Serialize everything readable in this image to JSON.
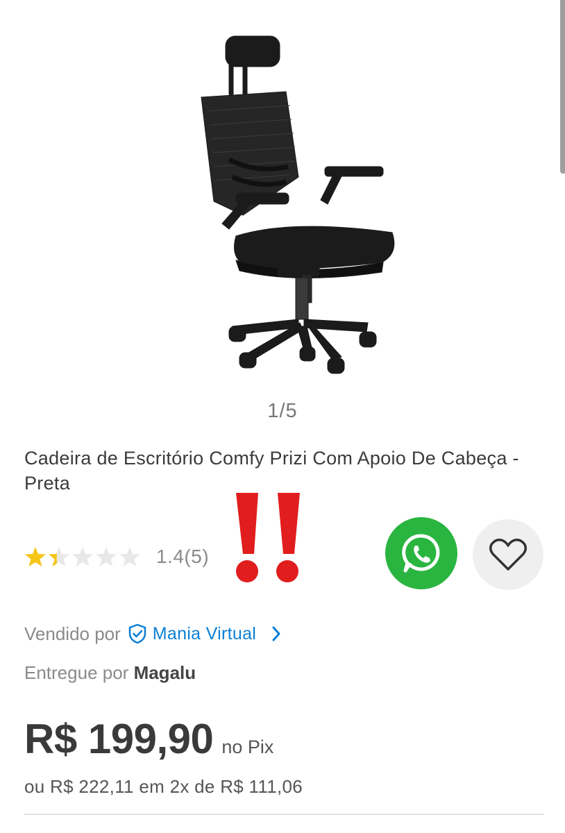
{
  "gallery": {
    "counter": "1/5"
  },
  "product": {
    "title": "Cadeira de Escritório Comfy Prizi Com Apoio De Cabeça - Preta"
  },
  "rating": {
    "value": 1.4,
    "max": 5,
    "text": "1.4(5)"
  },
  "seller": {
    "prefix": "Vendido por",
    "name": "Mania Virtual"
  },
  "delivery": {
    "prefix": "Entregue por",
    "name": "Magalu"
  },
  "price": {
    "main": "R$ 199,90",
    "suffix": "no Pix",
    "installment": "ou R$ 222,11 em 2x de R$ 111,06"
  },
  "icons": {
    "whatsapp": "whatsapp-icon",
    "favorite": "heart-outline-icon",
    "verified": "shield-check-icon",
    "chevron": "chevron-right-icon",
    "emphasis": "double-exclamation-icon"
  },
  "colors": {
    "whatsapp": "#2ab540",
    "link": "#0a7fd6",
    "star": "#f5c518",
    "star_empty": "#e8e8e8",
    "exclamation": "#e11d1d"
  }
}
